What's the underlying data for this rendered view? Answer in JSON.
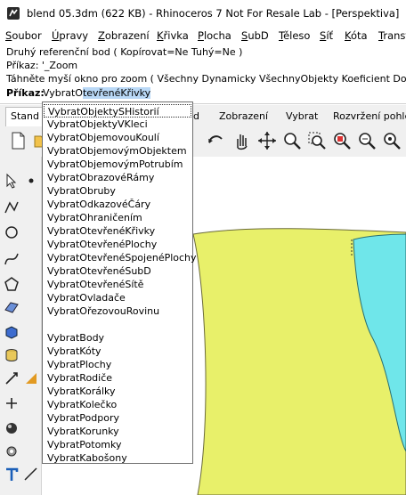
{
  "titlebar": {
    "title": "blend 05.3dm (622 KB) - Rhinoceros 7 Not For Resale Lab - [Perspektiva]"
  },
  "menubar": {
    "items": [
      "Soubor",
      "Úpravy",
      "Zobrazení",
      "Křivka",
      "Plocha",
      "SubD",
      "Těleso",
      "Síť",
      "Kóta",
      "Transf"
    ]
  },
  "command_history": {
    "lines": [
      "Druhý referenční bod ( Kopírovat=Ne  Tuhý=Ne )",
      "Příkaz: '_Zoom",
      "Táhněte myší okno pro zoom ( Všechny  Dynamicky  VšechnyObjekty  Koeficient  Dov"
    ]
  },
  "command_prompt": {
    "label": "Příkaz:",
    "typed_prefix": "VybratO",
    "autocomplete_suffix": "tevřenéKřivky"
  },
  "tabs": {
    "first": "Stand",
    "items": [
      "d",
      "Zobrazení",
      "Vybrat",
      "Rozvržení pohle"
    ]
  },
  "autocomplete": {
    "items": [
      "VybratObjektySHistorií",
      "VybratObjektyVKleci",
      "VybratObjemovouKoulí",
      "VybratObjemovýmObjektem",
      "VybratObjemovýmPotrubím",
      "VybratObrazovéRámy",
      "VybratObruby",
      "VybratOdkazovéČáry",
      "VybratOhraničením",
      "VybratOtevřenéKřivky",
      "VybratOtevřenéPlochy",
      "VybratOtevřenéSpojenéPlochy",
      "VybratOtevřenéSubD",
      "VybratOtevřenéSítě",
      "VybratOvladače",
      "VybratOřezovouRovinu",
      "",
      "VybratBody",
      "VybratKóty",
      "VybratPlochy",
      "VybratRodiče",
      "VybratKorálky",
      "VybratKolečko",
      "VybratPodpory",
      "VybratKorunky",
      "VybratPotomky",
      "VybratKabošony"
    ]
  },
  "colors": {
    "surface_yellow": "#e8f06a",
    "surface_cyan": "#6fe6ea",
    "selection_blue": "#b9d8f6"
  }
}
